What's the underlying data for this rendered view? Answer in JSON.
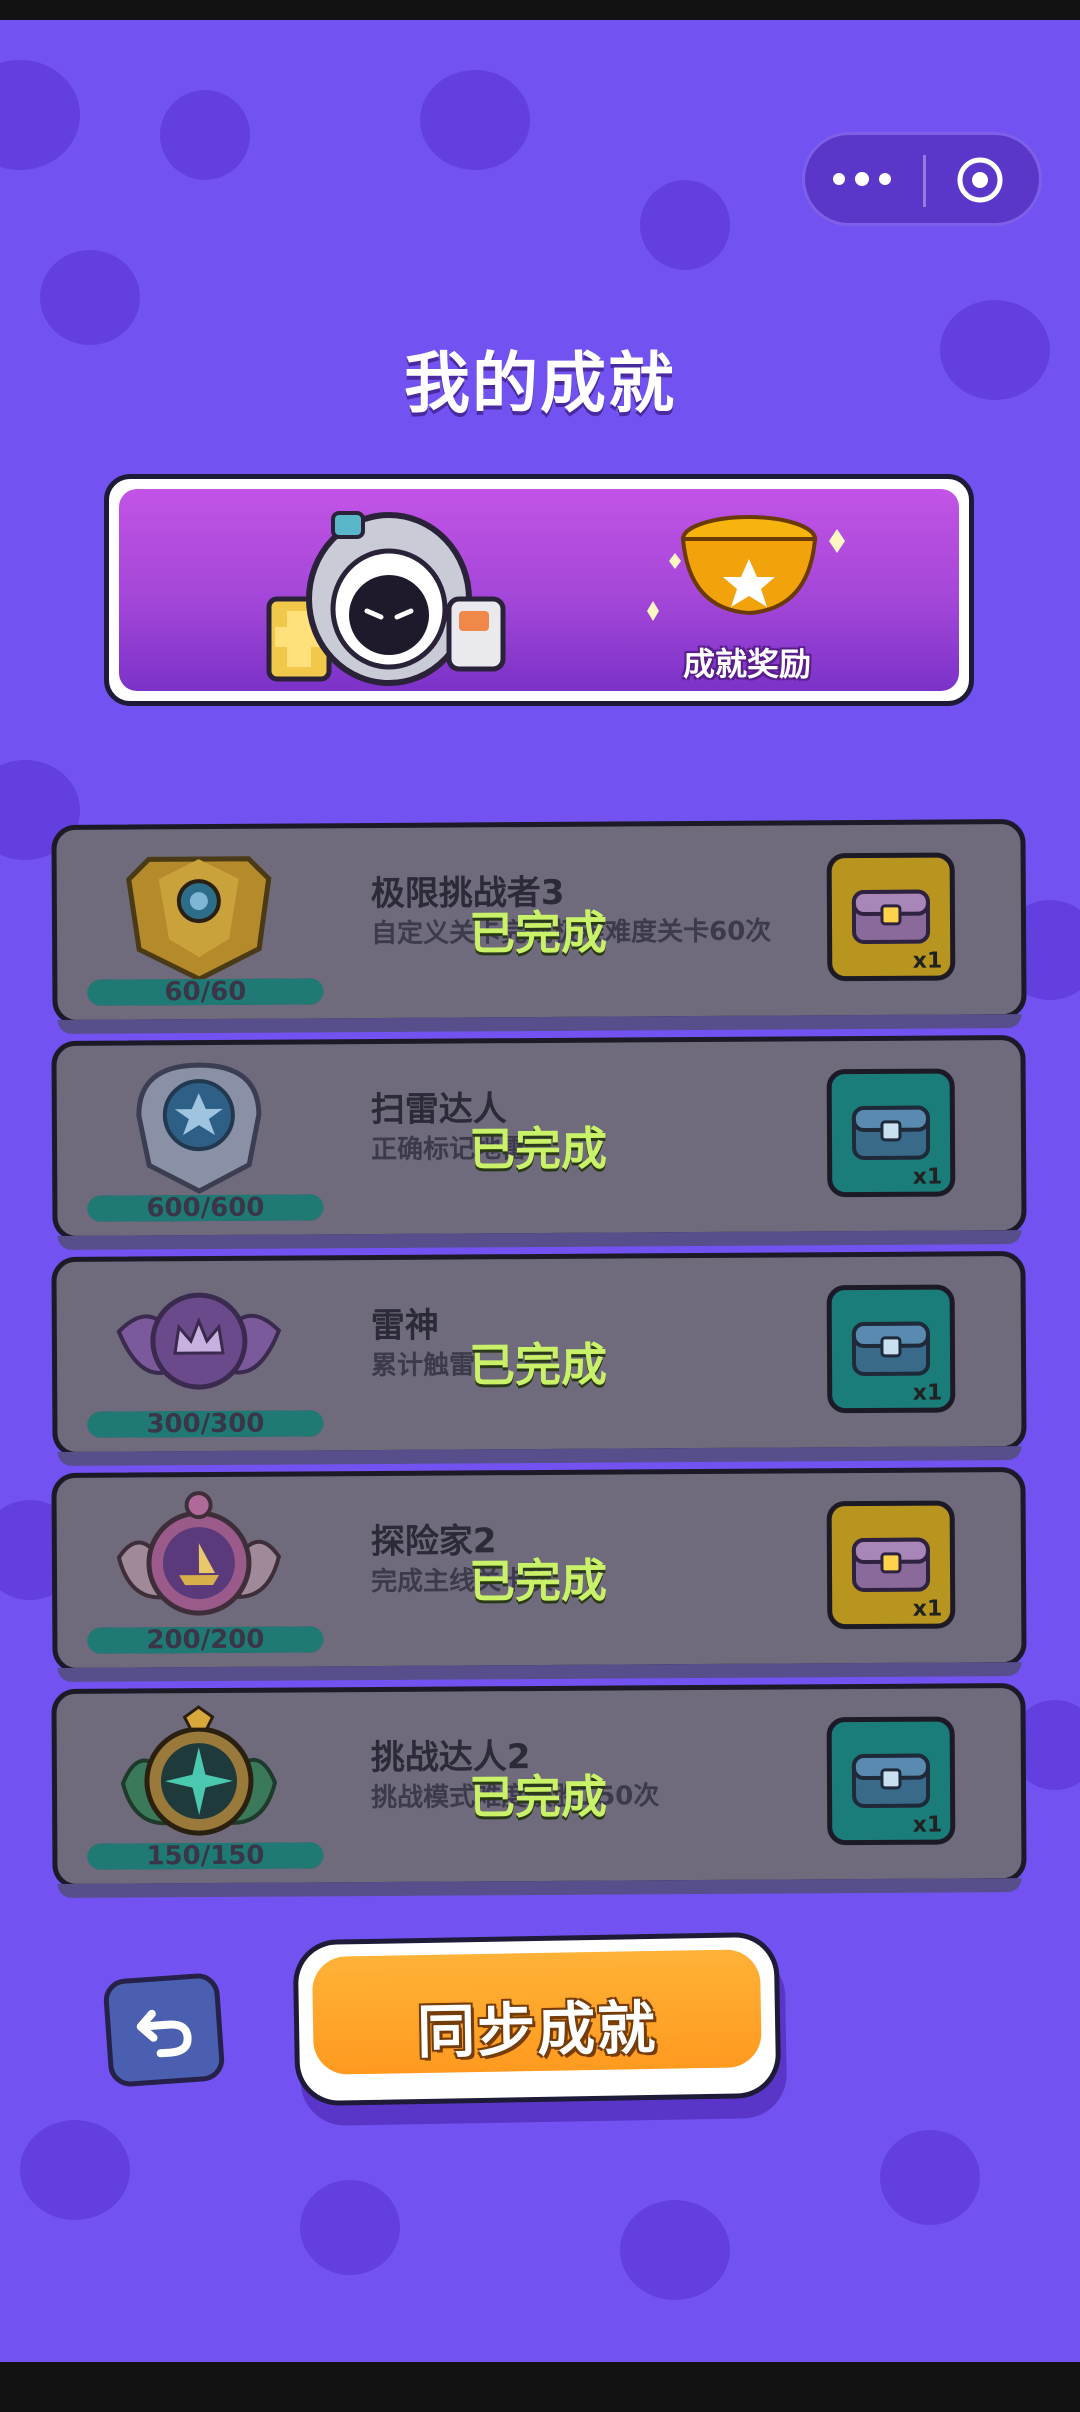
{
  "page": {
    "title": "我的成就",
    "banner_label": "成就奖励",
    "sync_button_label": "同步成就"
  },
  "achievements": [
    {
      "title": "极限挑战者3",
      "description": "自定义关卡完成极难难度关卡60次",
      "progress_text": "60/60",
      "progress": 1.0,
      "status": "已完成",
      "reward_count": "x1",
      "reward_color": "#b8951e",
      "badge_icon": "gold-wing-badge-icon"
    },
    {
      "title": "扫雷达人",
      "description": "正确标记地雷",
      "progress_text": "600/600",
      "progress": 1.0,
      "status": "已完成",
      "reward_count": "x1",
      "reward_color": "#1b7d7a",
      "badge_icon": "silver-star-badge-icon"
    },
    {
      "title": "雷神",
      "description": "累计触雷",
      "progress_text": "300/300",
      "progress": 1.0,
      "status": "已完成",
      "reward_count": "x1",
      "reward_color": "#1b7d7a",
      "badge_icon": "purple-crown-badge-icon"
    },
    {
      "title": "探险家2",
      "description": "完成主线关卡次",
      "progress_text": "200/200",
      "progress": 1.0,
      "status": "已完成",
      "reward_count": "x1",
      "reward_color": "#b8951e",
      "badge_icon": "pink-ship-badge-icon"
    },
    {
      "title": "挑战达人2",
      "description": "挑战模式难度获胜150次",
      "progress_text": "150/150",
      "progress": 1.0,
      "status": "已完成",
      "reward_count": "x1",
      "reward_color": "#1b7d7a",
      "badge_icon": "green-compass-badge-icon"
    }
  ],
  "colors": {
    "background": "#7352f2",
    "done_text": "#c9f269",
    "button": "#ff9a1f"
  }
}
